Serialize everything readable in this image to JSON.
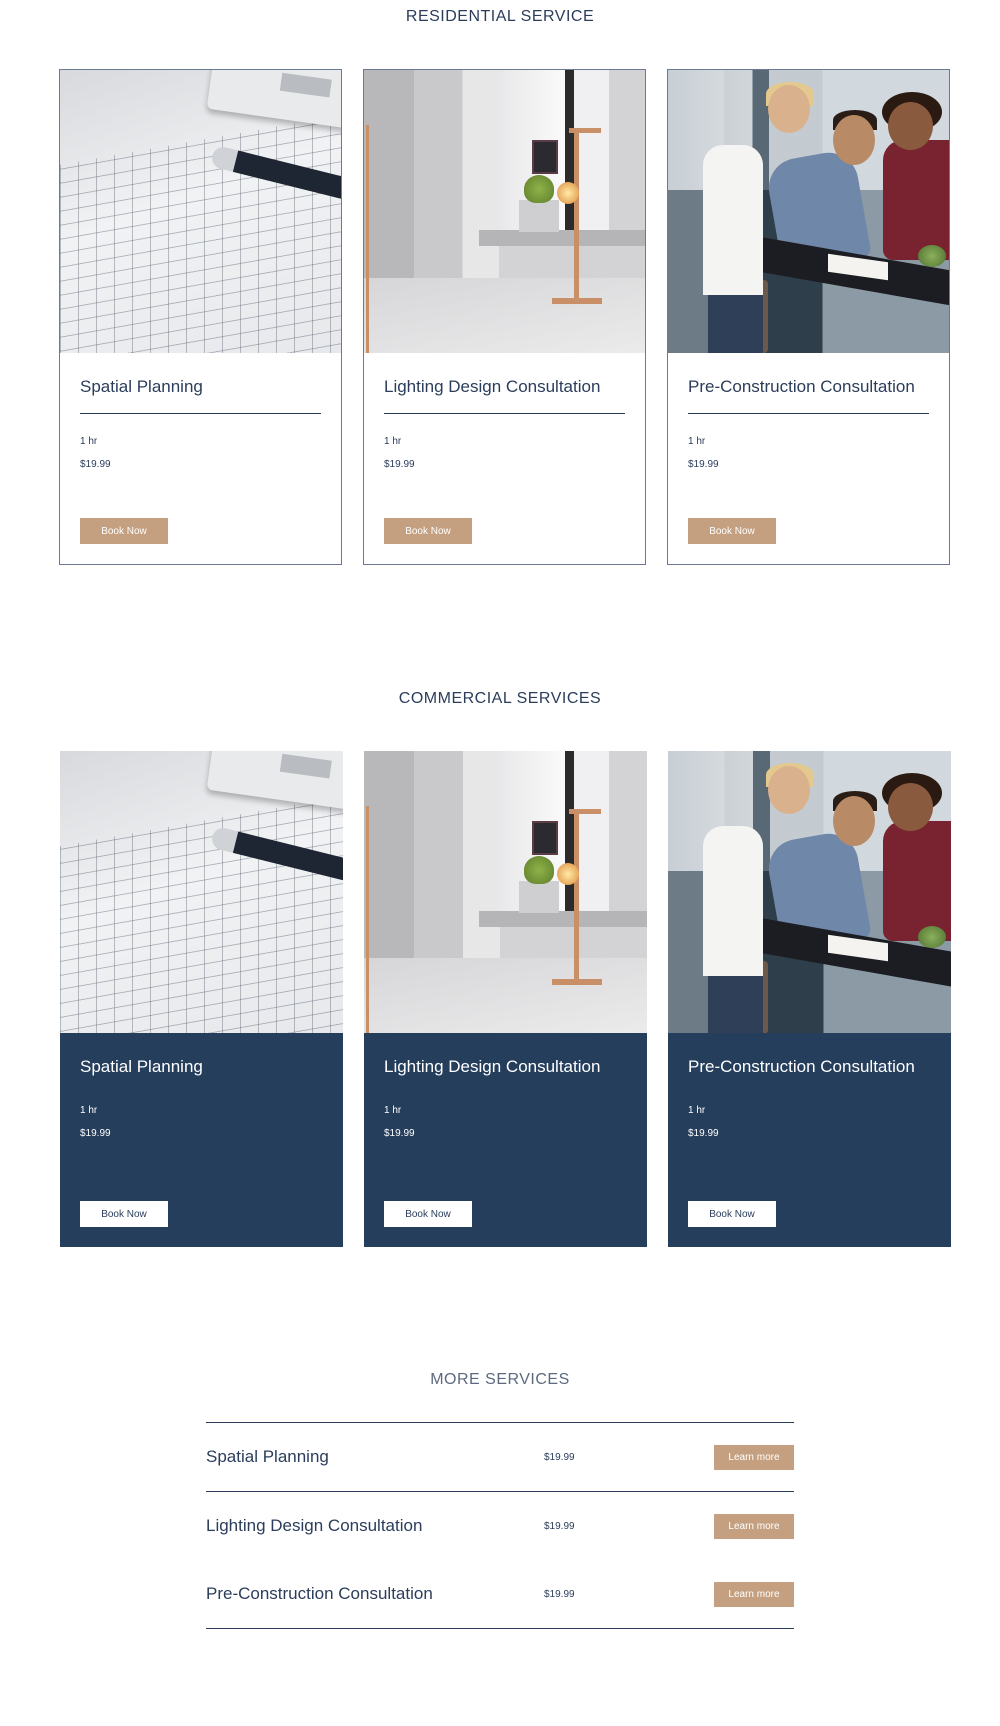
{
  "residential": {
    "title": "RESIDENTIAL SERVICE",
    "cards": [
      {
        "name": "Spatial Planning",
        "duration": "1 hr",
        "price": "$19.99",
        "button": "Book Now",
        "image": "blueprint-image"
      },
      {
        "name": "Lighting Design Consultation",
        "duration": "1 hr",
        "price": "$19.99",
        "button": "Book Now",
        "image": "lamp-image"
      },
      {
        "name": "Pre-Construction Consultation",
        "duration": "1 hr",
        "price": "$19.99",
        "button": "Book Now",
        "image": "team-meeting-image"
      }
    ]
  },
  "commercial": {
    "title": "COMMERCIAL SERVICES",
    "cards": [
      {
        "name": "Spatial Planning",
        "duration": "1 hr",
        "price": "$19.99",
        "button": "Book Now",
        "image": "blueprint-image"
      },
      {
        "name": "Lighting Design Consultation",
        "duration": "1 hr",
        "price": "$19.99",
        "button": "Book Now",
        "image": "lamp-image"
      },
      {
        "name": "Pre-Construction Consultation",
        "duration": "1 hr",
        "price": "$19.99",
        "button": "Book Now",
        "image": "team-meeting-image"
      }
    ]
  },
  "more": {
    "title": "MORE SERVICES",
    "items": [
      {
        "name": "Spatial Planning",
        "price": "$19.99",
        "button": "Learn more"
      },
      {
        "name": "Lighting Design Consultation",
        "price": "$19.99",
        "button": "Learn more"
      },
      {
        "name": "Pre-Construction Consultation",
        "price": "$19.99",
        "button": "Learn more"
      }
    ]
  },
  "colors": {
    "navy": "#253e5c",
    "text": "#2b3d5b",
    "accent": "#c4a081",
    "background": "#ffffff"
  }
}
